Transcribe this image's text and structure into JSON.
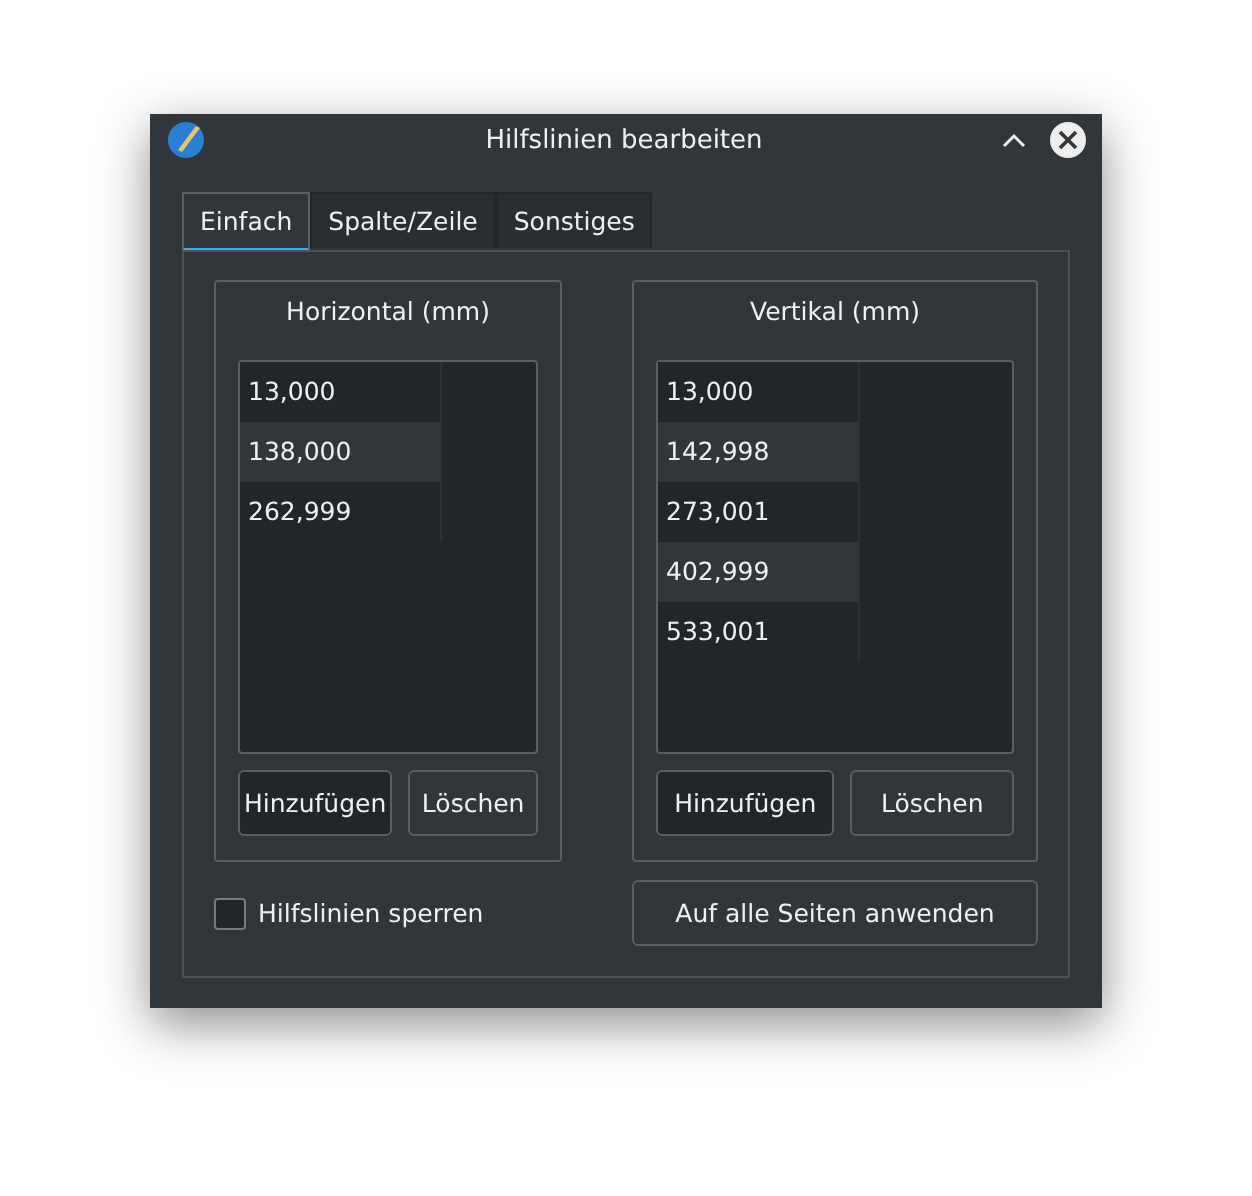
{
  "window": {
    "title": "Hilfslinien bearbeiten"
  },
  "tabs": [
    {
      "label": "Einfach",
      "selected": true
    },
    {
      "label": "Spalte/Zeile",
      "selected": false
    },
    {
      "label": "Sonstiges",
      "selected": false
    }
  ],
  "groups": [
    {
      "title": "Horizontal (mm)",
      "values": [
        "13,000",
        "138,000",
        "262,999"
      ],
      "buttons": [
        "Hinzufügen",
        "Löschen"
      ]
    },
    {
      "title": "Vertikal (mm)",
      "values": [
        "13,000",
        "142,998",
        "273,001",
        "402,999",
        "533,001"
      ],
      "buttons": [
        "Hinzufügen",
        "Löschen"
      ]
    }
  ],
  "lock_checkbox": {
    "label": "Hilfslinien sperren",
    "checked": false
  },
  "apply_button": "Auf alle Seiten anwenden"
}
